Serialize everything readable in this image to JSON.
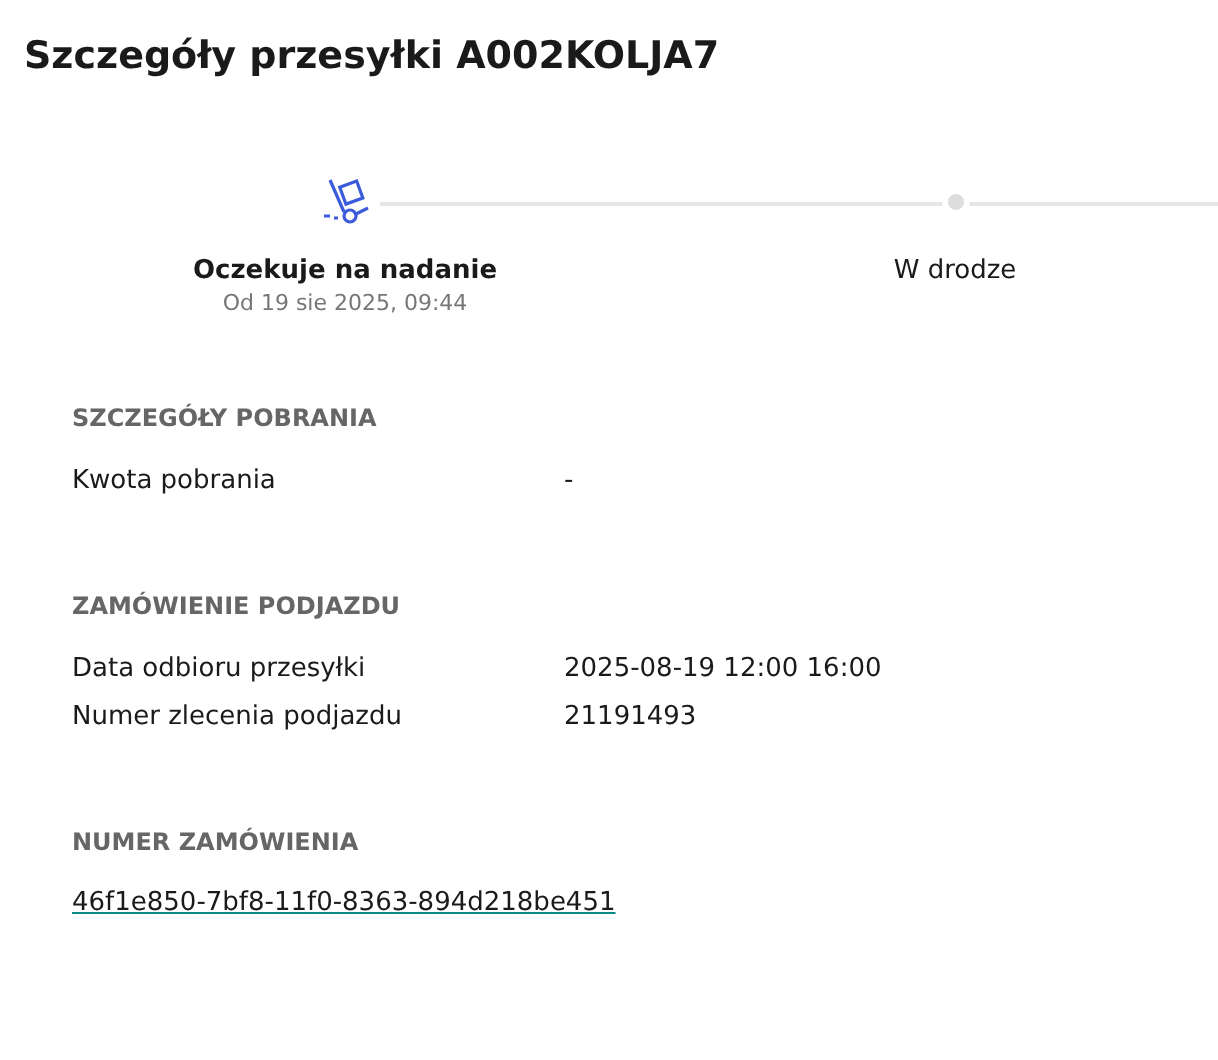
{
  "title": "Szczegóły przesyłki A002KOLJA7",
  "steps": [
    {
      "label": "Oczekuje na nadanie",
      "date": "Od 19 sie 2025, 09:44",
      "active": true
    },
    {
      "label": "W drodze",
      "active": false
    }
  ],
  "sections": [
    {
      "heading": "SZCZEGÓŁY POBRANIA",
      "rows": [
        {
          "label": "Kwota pobrania",
          "value": "-"
        }
      ]
    },
    {
      "heading": "ZAMÓWIENIE PODJAZDU",
      "rows": [
        {
          "label": "Data odbioru przesyłki",
          "value": "2025-08-19 12:00 16:00"
        },
        {
          "label": "Numer zlecenia podjazdu",
          "value": "21191493"
        }
      ]
    },
    {
      "heading": "NUMER ZAMÓWIENIA",
      "link": "46f1e850-7bf8-11f0-8363-894d218be451"
    }
  ]
}
